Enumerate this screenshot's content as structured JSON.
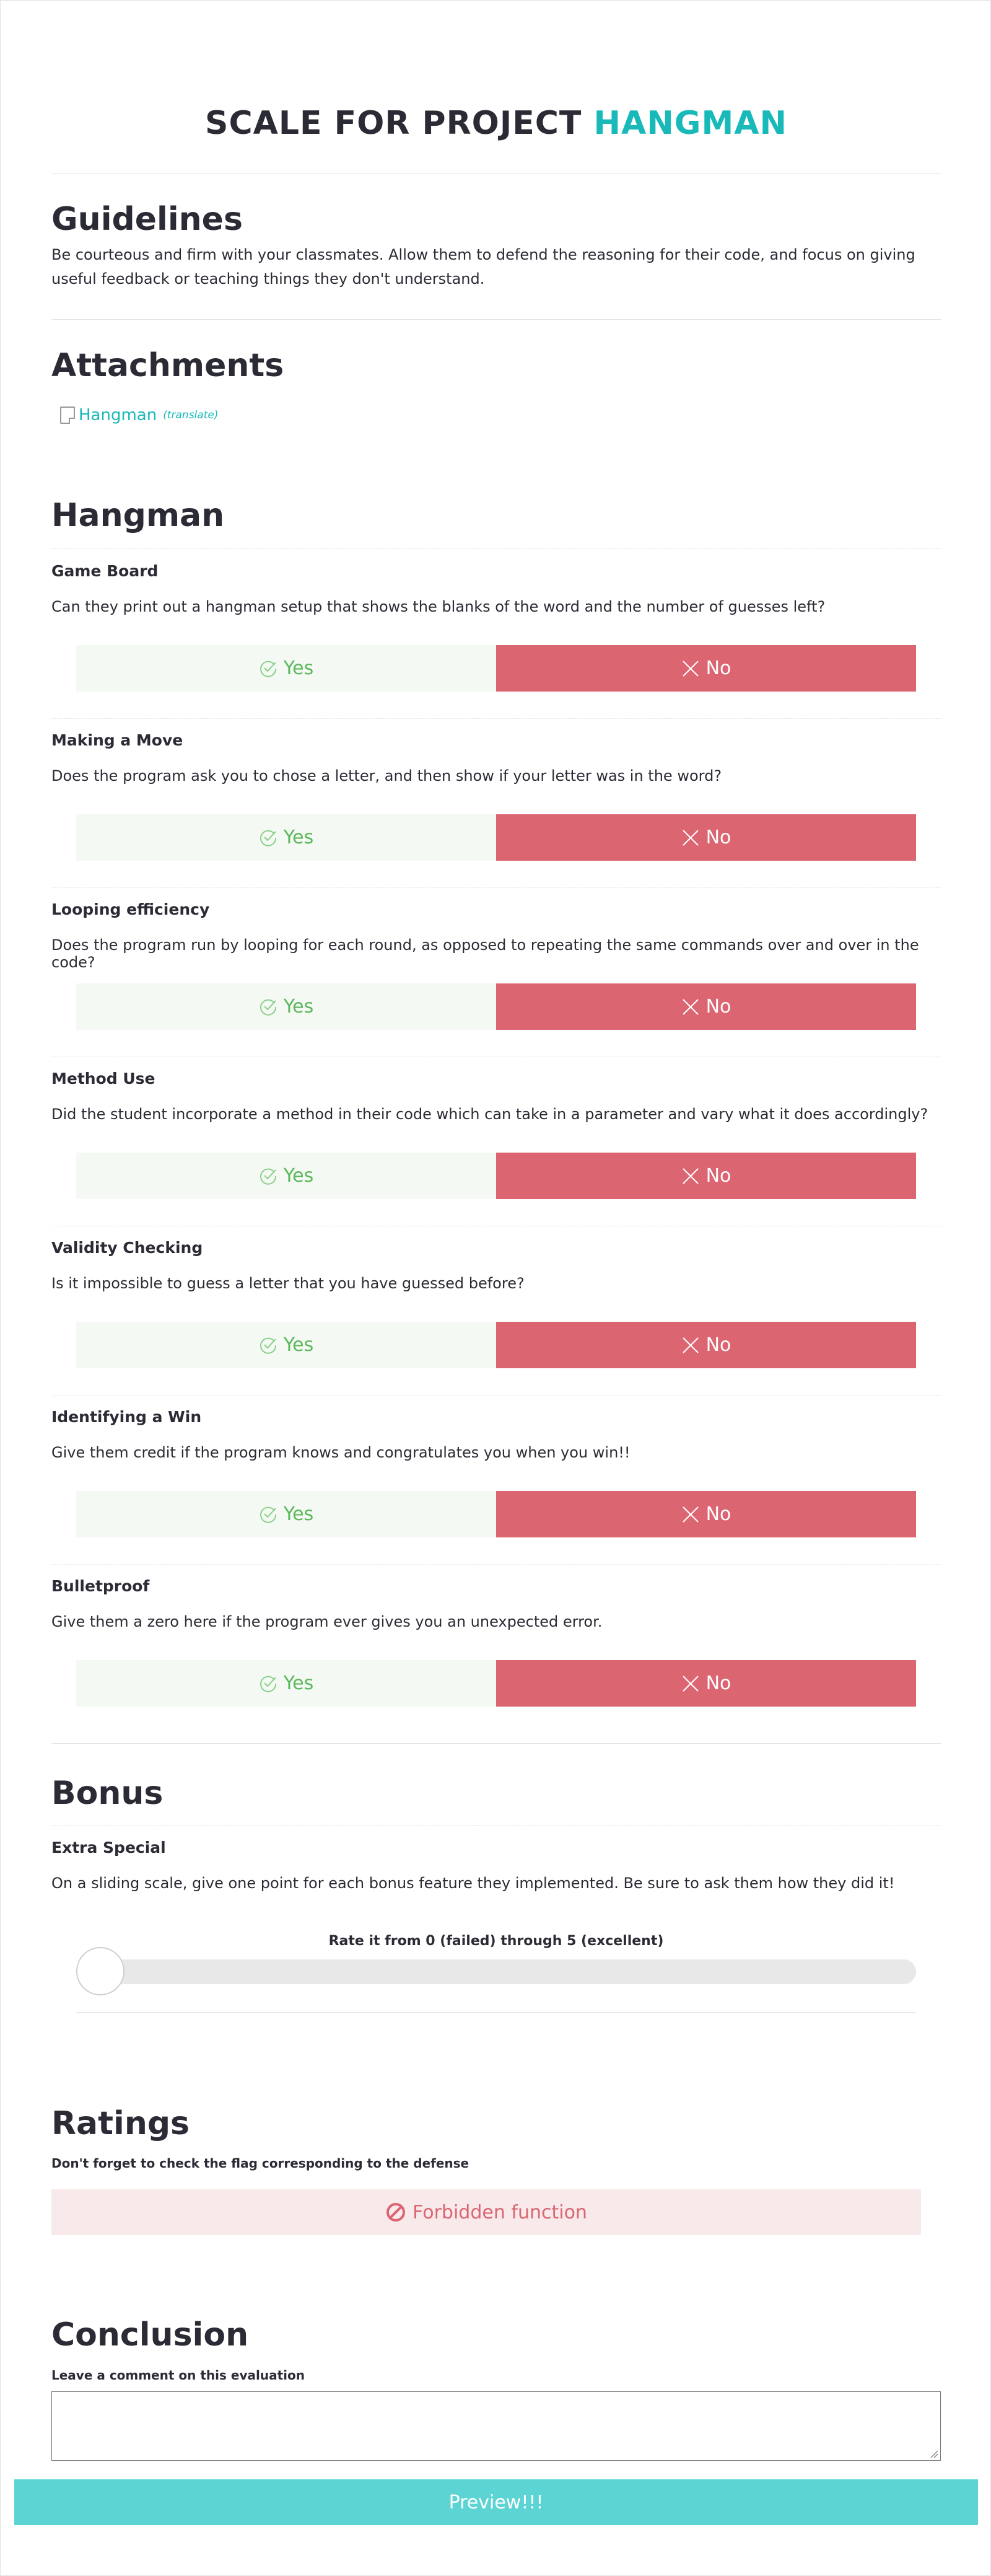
{
  "header": {
    "title_prefix": "SCALE FOR PROJECT",
    "title_project": "HANGMAN"
  },
  "guidelines": {
    "heading": "Guidelines",
    "text": "Be courteous and firm with your classmates. Allow them to defend the reasoning for their code, and focus on giving useful feedback or teaching things they don't understand."
  },
  "attachments": {
    "heading": "Attachments",
    "items": [
      {
        "label": "Hangman",
        "sub": "(translate)",
        "icon": "document-icon"
      }
    ]
  },
  "section": {
    "heading": "Hangman",
    "yes_label": "Yes",
    "no_label": "No",
    "yes_icon": "check-icon",
    "no_icon": "close-icon",
    "questions": [
      {
        "title": "Game Board",
        "text": "Can they print out a hangman setup that shows the blanks of the word and the number of guesses left?"
      },
      {
        "title": "Making a Move",
        "text": "Does the program ask you to chose a letter, and then show if your letter was in the word?"
      },
      {
        "title": "Looping efficiency",
        "text": "Does the program run by looping for each round, as opposed to repeating the same commands over and over in the code?"
      },
      {
        "title": "Method Use",
        "text": "Did the student incorporate a method in their code which can take in a parameter and vary what it does accordingly?"
      },
      {
        "title": "Validity Checking",
        "text": "Is it impossible to guess a letter that you have guessed before?"
      },
      {
        "title": "Identifying a Win",
        "text": "Give them credit if the program knows and congratulates you when you win!!"
      },
      {
        "title": "Bulletproof",
        "text": "Give them a zero here if the program ever gives you an unexpected error."
      }
    ]
  },
  "bonus": {
    "heading": "Bonus",
    "question_title": "Extra Special",
    "question_text": "On a sliding scale, give one point for each bonus feature they implemented. Be sure to ask them how they did it!",
    "slider_label": "Rate it from 0 (failed) through 5 (excellent)",
    "slider_value": 0,
    "slider_max": 5
  },
  "ratings": {
    "heading": "Ratings",
    "subtitle": "Don't forget to check the flag corresponding to the defense",
    "flag_label": "Forbidden function",
    "flag_icon": "forbidden-icon"
  },
  "conclusion": {
    "heading": "Conclusion",
    "subtitle": "Leave a comment on this evaluation",
    "comment_value": ""
  },
  "footer": {
    "button_label": "Preview!!!"
  },
  "colors": {
    "accent": "#19b9b9",
    "yes_bg": "#f4f9f3",
    "yes_text": "#5cb85c",
    "no_bg": "#dc6572",
    "flag_bg": "#f8eaea",
    "preview_bg": "#5bd4d3"
  }
}
